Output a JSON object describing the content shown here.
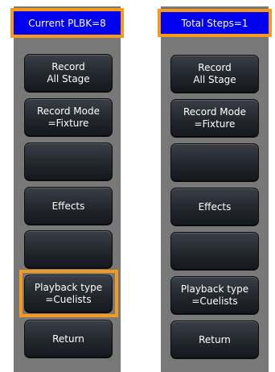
{
  "left_panel": {
    "header": "Current PLBK=8",
    "buttons": [
      {
        "line1": "Record",
        "line2": "All Stage"
      },
      {
        "line1": "Record Mode",
        "line2": "=Fixture"
      },
      {
        "line1": "",
        "line2": ""
      },
      {
        "line1": "Effects",
        "line2": ""
      },
      {
        "line1": "",
        "line2": ""
      },
      {
        "line1": "Playback type",
        "line2": "=Cuelists"
      },
      {
        "line1": "Return",
        "line2": ""
      }
    ]
  },
  "right_panel": {
    "header": "Total Steps=1",
    "buttons": [
      {
        "line1": "Record",
        "line2": "All Stage"
      },
      {
        "line1": "Record Mode",
        "line2": "=Fixture"
      },
      {
        "line1": "",
        "line2": ""
      },
      {
        "line1": "Effects",
        "line2": ""
      },
      {
        "line1": "",
        "line2": ""
      },
      {
        "line1": "Playback type",
        "line2": "=Cuelists"
      },
      {
        "line1": "Return",
        "line2": ""
      }
    ]
  },
  "colors": {
    "header_bg": "#0000ee",
    "highlight": "#f59a1a",
    "panel_bg": "#787878"
  }
}
